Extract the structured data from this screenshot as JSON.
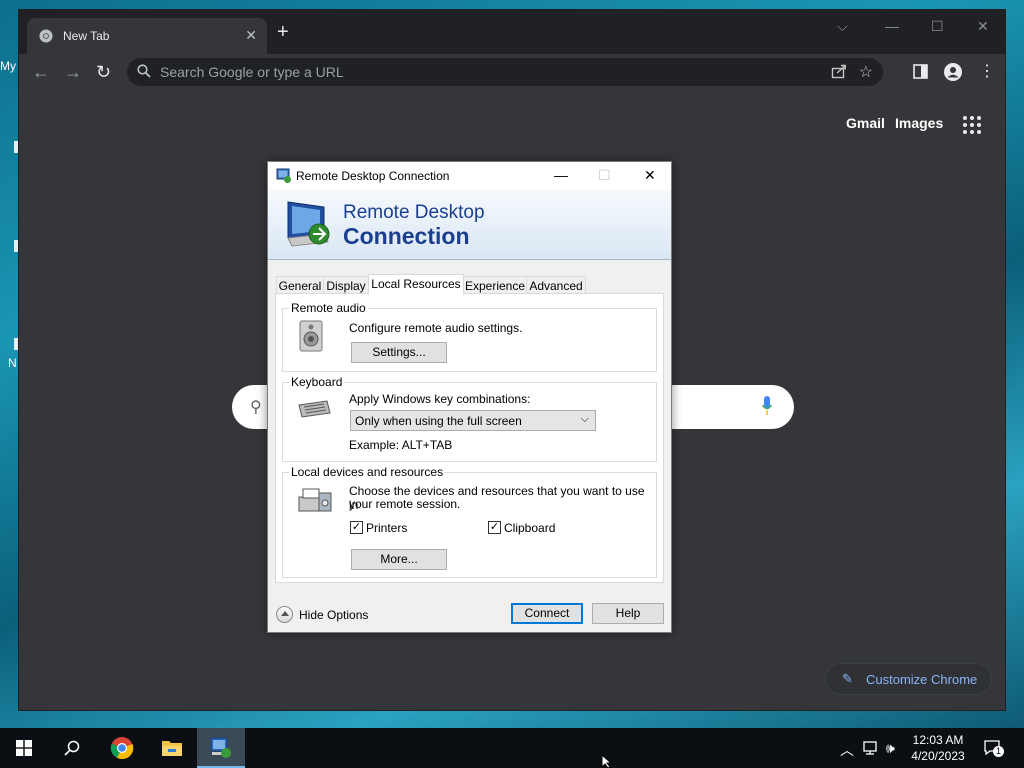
{
  "desktop": {
    "fragments": [
      "My",
      "N"
    ]
  },
  "chrome": {
    "tab": {
      "title": "New Tab",
      "close": "✕"
    },
    "new_tab": "+",
    "window_controls": {
      "list": "⌵",
      "minimize": "—",
      "maximize": "☐",
      "close": "✕"
    },
    "toolbar": {
      "back": "←",
      "forward": "→",
      "reload": "↻",
      "omnibox_placeholder": "Search Google or type a URL"
    },
    "ntp": {
      "gmail": "Gmail",
      "images": "Images",
      "customize": "Customize Chrome"
    }
  },
  "rdc": {
    "title": "Remote Desktop Connection",
    "banner": {
      "line1": "Remote Desktop",
      "line2": "Connection"
    },
    "tabs": [
      "General",
      "Display",
      "Local Resources",
      "Experience",
      "Advanced"
    ],
    "active_tab": "Local Resources",
    "remote_audio": {
      "label": "Remote audio",
      "description": "Configure remote audio settings.",
      "button": "Settings..."
    },
    "keyboard": {
      "label": "Keyboard",
      "description": "Apply Windows key combinations:",
      "selected": "Only when using the full screen",
      "example": "Example: ALT+TAB"
    },
    "local_devices": {
      "label": "Local devices and resources",
      "description_line1": "Choose the devices and resources that you want to use in",
      "description_line2": "your remote session.",
      "printers": {
        "label": "Printers",
        "checked": true
      },
      "clipboard": {
        "label": "Clipboard",
        "checked": true
      },
      "more_button": "More..."
    },
    "hide_options": "Hide Options",
    "connect": "Connect",
    "help": "Help"
  },
  "taskbar": {
    "clock_time": "12:03 AM",
    "clock_date": "4/20/2023",
    "notification_count": "1"
  }
}
